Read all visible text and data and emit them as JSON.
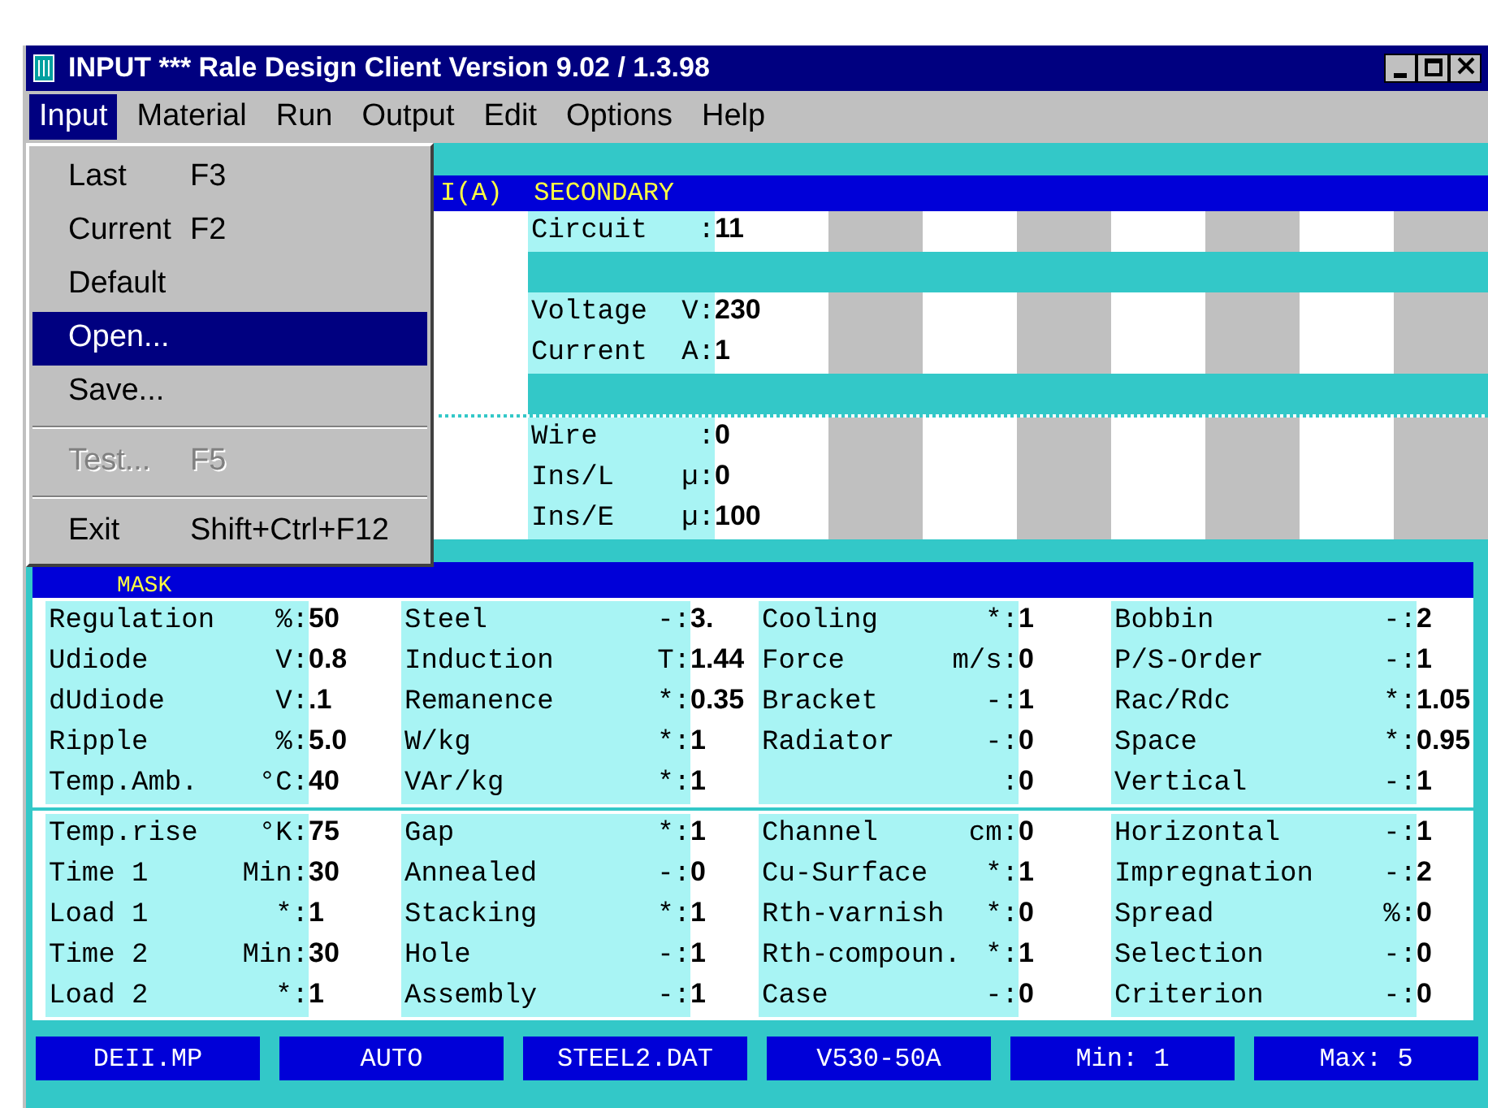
{
  "window": {
    "title": "INPUT *** Rale Design Client Version 9.02 / 1.3.98"
  },
  "menu_bar": [
    {
      "label": "Input",
      "selected": true
    },
    {
      "label": "Material",
      "selected": false
    },
    {
      "label": "Run",
      "selected": false
    },
    {
      "label": "Output",
      "selected": false
    },
    {
      "label": "Edit",
      "selected": false
    },
    {
      "label": "Options",
      "selected": false
    },
    {
      "label": "Help",
      "selected": false
    }
  ],
  "dropdown": [
    {
      "kind": "item",
      "label": "Last",
      "shortcut": "F3",
      "selected": false,
      "disabled": false
    },
    {
      "kind": "item",
      "label": "Current",
      "shortcut": "F2",
      "selected": false,
      "disabled": false
    },
    {
      "kind": "item",
      "label": "Default",
      "selected": false,
      "disabled": false
    },
    {
      "kind": "item",
      "label": "Open...",
      "selected": true,
      "disabled": false
    },
    {
      "kind": "item",
      "label": "Save...",
      "selected": false,
      "disabled": false
    },
    {
      "kind": "separator"
    },
    {
      "kind": "item",
      "label": "Test...",
      "shortcut": "F5",
      "selected": false,
      "disabled": true
    },
    {
      "kind": "separator"
    },
    {
      "kind": "item",
      "label": "Exit",
      "shortcut": "Shift+Ctrl+F12",
      "selected": false,
      "disabled": false
    }
  ],
  "secondary": {
    "title": "I(A)  SECONDARY",
    "sections": [
      [
        {
          "label": "Circuit",
          "unit": ":",
          "value": "11"
        }
      ],
      [
        {
          "label": "Voltage",
          "unit": "V:",
          "value": "230"
        },
        {
          "label": "Current",
          "unit": "A:",
          "value": "1"
        }
      ],
      [
        {
          "label": "Wire",
          "unit": ":",
          "value": "0"
        },
        {
          "label": "Ins/L",
          "unit": "µ:",
          "value": "0"
        },
        {
          "label": "Ins/E",
          "unit": "µ:",
          "value": "100"
        }
      ]
    ]
  },
  "mask": {
    "title": "MASK",
    "sections": [
      [
        [
          {
            "label": "Regulation",
            "unit": "%:",
            "value": "50"
          },
          {
            "label": "Steel",
            "unit": "-:",
            "value": "3."
          },
          {
            "label": "Cooling",
            "unit": "*:",
            "value": "1"
          },
          {
            "label": "Bobbin",
            "unit": "-:",
            "value": "2"
          }
        ],
        [
          {
            "label": "Udiode",
            "unit": "V:",
            "value": "0.8"
          },
          {
            "label": "Induction",
            "unit": "T:",
            "value": "1.44"
          },
          {
            "label": "Force",
            "unit": "m/s:",
            "value": "0"
          },
          {
            "label": "P/S-Order",
            "unit": "-:",
            "value": "1"
          }
        ],
        [
          {
            "label": "dUdiode",
            "unit": "V:",
            "value": ".1"
          },
          {
            "label": "Remanence",
            "unit": "*:",
            "value": "0.35"
          },
          {
            "label": "Bracket",
            "unit": "-:",
            "value": "1"
          },
          {
            "label": "Rac/Rdc",
            "unit": "*:",
            "value": "1.05"
          }
        ],
        [
          {
            "label": "Ripple",
            "unit": "%:",
            "value": "5.0"
          },
          {
            "label": "W/kg",
            "unit": "*:",
            "value": "1"
          },
          {
            "label": "Radiator",
            "unit": "-:",
            "value": "0"
          },
          {
            "label": "Space",
            "unit": "*:",
            "value": "0.95"
          }
        ],
        [
          {
            "label": "Temp.Amb.",
            "unit": "°C:",
            "value": "40"
          },
          {
            "label": "VAr/kg",
            "unit": "*:",
            "value": "1"
          },
          {
            "unit": ":",
            "value": "0"
          },
          {
            "label": "Vertical",
            "unit": "-:",
            "value": "1"
          }
        ]
      ],
      [
        [
          {
            "label": "Temp.rise",
            "unit": "°K:",
            "value": "75"
          },
          {
            "label": "Gap",
            "unit": "*:",
            "value": "1"
          },
          {
            "label": "Channel",
            "unit": "cm:",
            "value": "0"
          },
          {
            "label": "Horizontal",
            "unit": "-:",
            "value": "1"
          }
        ],
        [
          {
            "label": "Time 1",
            "unit": "Min:",
            "value": "30"
          },
          {
            "label": "Annealed",
            "unit": "-:",
            "value": "0"
          },
          {
            "label": "Cu-Surface",
            "unit": "*:",
            "value": "1"
          },
          {
            "label": "Impregnation",
            "unit": "-:",
            "value": "2"
          }
        ],
        [
          {
            "label": "Load 1",
            "unit": "*:",
            "value": "1"
          },
          {
            "label": "Stacking",
            "unit": "*:",
            "value": "1"
          },
          {
            "label": "Rth-varnish",
            "unit": "*:",
            "value": "0"
          },
          {
            "label": "Spread",
            "unit": "%:",
            "value": "0"
          }
        ],
        [
          {
            "label": "Time 2",
            "unit": "Min:",
            "value": "30"
          },
          {
            "label": "Hole",
            "unit": "-:",
            "value": "1"
          },
          {
            "label": "Rth-compoun.",
            "unit": "*:",
            "value": "1"
          },
          {
            "label": "Selection",
            "unit": "-:",
            "value": "0"
          }
        ],
        [
          {
            "label": "Load 2",
            "unit": "*:",
            "value": "1"
          },
          {
            "label": "Assembly",
            "unit": "-:",
            "value": "1"
          },
          {
            "label": "Case",
            "unit": "-:",
            "value": "0"
          },
          {
            "label": "Criterion",
            "unit": "-:",
            "value": "0"
          }
        ]
      ]
    ]
  },
  "status_bar": [
    "DEII.MP",
    "AUTO",
    "STEEL2.DAT",
    "V530-50A",
    "Min: 1",
    "Max: 5"
  ]
}
